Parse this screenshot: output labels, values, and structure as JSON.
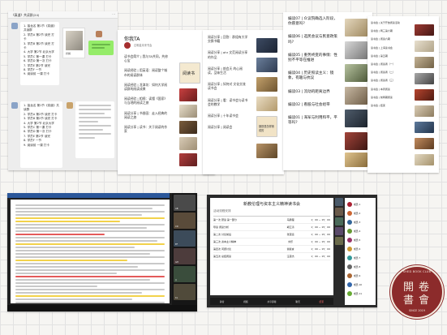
{
  "panel1": {
    "header_title": "《真道》共读群(24)",
    "lines": [
      "1. 接龙名 第1节《真道》共读群",
      "2. 学员A 第2节 读完 打卡",
      "3. 学员B 第2节 读完 打卡",
      "4. 大学 第2节 北京大学",
      "5. 学员C 第一课 打卡",
      "6. 学员D 第一次 打卡",
      "7. 学员E 第2节 读完",
      "8. 学员F 一节",
      "9. 阅读前 一课 打卡"
    ],
    "card_text": "拆解"
  },
  "panel2": {
    "header_title": "你我TA",
    "subtitle": "达明星未来书会",
    "items": [
      "读书会简介 | 我与TA共同，共修心宝",
      "阅读经验 | 用英语：阅读整个城市的阅读群体",
      "阅读经验 | 龙津坊：如何大学阅读群的阅读成果",
      "阅读经验 | 相视：读懂《国家》与当地的阅读之旅",
      "阅读分享 | 书香园：走入经典的阅读之旅",
      "阅读分享 | 读书：关于阅读的作家"
    ],
    "items2": [
      "阅读分享 | 回答：群组有大学交换书籍",
      "阅读分享 | ahr 文范阅读分享的作品",
      "阅读分享 | 前会天 的心阅读，品味生活",
      "阅读分享 | 如何对 文化交流读书会",
      "阅读分享 | 看：读书会与读书会的教学",
      "阅读分享 | 十年读书会",
      "阅读分享 | 阅读会"
    ],
    "book_title": "阅读书",
    "book_title2": "钢铁是怎样炼成的"
  },
  "panel3": {
    "items": [
      "编读07 | 众议院确选入阶段，你愿意吗?",
      "编读06 | 选民会议与民意政策吗?",
      "编读05 | 重势终变的事情：性别不平等在推进",
      "编读04 | 历史照读主义：镜象，有趣与抗议",
      "编读03 | 流动的距离边界",
      "编读02 | 看股与社会组带",
      "编读01 | 海军与利用和平，平等吗?"
    ],
    "side_items": [
      "读书会 | 关于开放阅读活动",
      "读书会 | 两三第六期",
      "读书会 | 阅读六期",
      "读书会 | 上海读书会",
      "读书会 | 第五期",
      "读书会 | 阅读者（一）",
      "读书会 | 阅读者（二）",
      "读书会 | 阅读者（三）",
      "读书会 | 本周阅读",
      "读书会 | 前两期阅读",
      "读书会 | 结束"
    ]
  },
  "panel4": {
    "zoom_name": "Zoom",
    "participants": [
      "AB",
      "CD",
      "EF",
      "GH",
      "IJ",
      "KL"
    ]
  },
  "panel5": {
    "title": "新教伦理与资本主义精神读书会",
    "subtitle": "活动流程安排",
    "rows": [
      {
        "text": "第一次 研读 第一部分",
        "name": "马鹏程",
        "time": "1：00 ~ 15：00"
      },
      {
        "text": "导读 阅读分析",
        "name": "胡江涛",
        "time": "1：00 ~ 15：00"
      },
      {
        "text": "第二次 讨论前后",
        "name": "张思远",
        "time": "1：00 ~ 15：00"
      },
      {
        "text": "第三次 资本主义精神",
        "name": "刘乐",
        "time": "1：00 ~ 15：00"
      },
      {
        "text": "第四次 问题讨论",
        "name": "谢嘉言",
        "time": "1：00 ~ 15：00"
      },
      {
        "text": "第五次 总结阅读",
        "name": "汪思杰",
        "time": "1：00 ~ 15：00"
      }
    ],
    "controls": [
      "静音",
      "视频",
      "共享屏幕",
      "聊天",
      "结束"
    ],
    "members": [
      "成员 1",
      "成员 2",
      "成员 3",
      "成员 4",
      "成员 5",
      "成员 6",
      "成员 7",
      "成员 8",
      "成员 9",
      "成员 10",
      "成员 11"
    ]
  },
  "logo": {
    "top_text": "SHED BOOK CLUB",
    "chars": [
      "開",
      "卷",
      "書",
      "會"
    ],
    "bottom_text": "SINCE 2019",
    "colors": {
      "red": "#8c2b2b",
      "cream": "#f3eadf"
    }
  }
}
